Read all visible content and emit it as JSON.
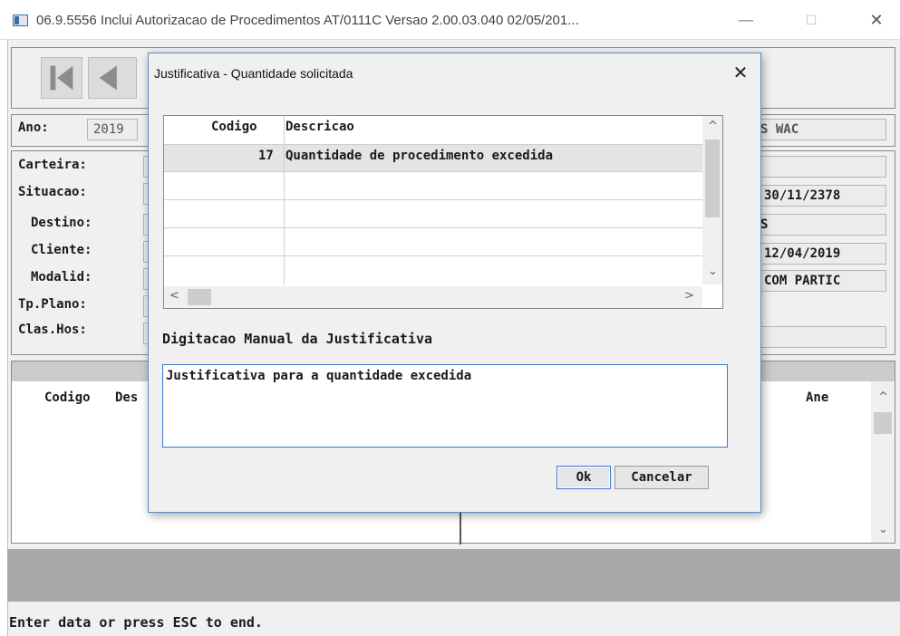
{
  "window": {
    "title": "06.9.5556   Inclui Autorizacao de Procedimentos AT/0111C Versao 2.00.03.040 02/05/201...",
    "minimize": "—",
    "maximize": "☐",
    "close": "✕"
  },
  "form": {
    "ano_label": "Ano:",
    "ano_value": "2019",
    "carteira_label": "Carteira:",
    "situacao_label": "Situacao:",
    "destino_label": "Destino:",
    "cliente_label": "Cliente:",
    "modalid_label": "Modalid:",
    "tpplano_label": "Tp.Plano:",
    "claship_label": "Clas.Hos:",
    "right_fields": [
      "S WAC",
      "",
      "30/11/2378",
      "S",
      "12/04/2019",
      "COM PARTIC",
      "",
      ""
    ]
  },
  "lower_grid": {
    "col_codigo": "Codigo",
    "col_desc": "Des",
    "col_ane": "Ane"
  },
  "status_line": "Enter data or press ESC to end.",
  "dialog": {
    "title": "Justificativa - Quantidade solicitada",
    "close": "✕",
    "grid": {
      "headers": {
        "codigo": "Codigo",
        "descricao": "Descricao"
      },
      "rows": [
        {
          "codigo": "17",
          "descricao": "Quantidade de procedimento excedida"
        },
        {
          "codigo": "",
          "descricao": ""
        },
        {
          "codigo": "",
          "descricao": ""
        },
        {
          "codigo": "",
          "descricao": ""
        },
        {
          "codigo": "",
          "descricao": ""
        }
      ]
    },
    "manual_label": "Digitacao Manual da Justificativa",
    "manual_text": "Justificativa para a quantidade excedida",
    "ok_label": "Ok",
    "cancel_label": "Cancelar"
  },
  "icons": [
    "app-window-icon",
    "first-record-icon",
    "previous-record-icon",
    "scroll-up-icon",
    "scroll-down-icon",
    "scroll-left-icon",
    "scroll-right-icon"
  ]
}
